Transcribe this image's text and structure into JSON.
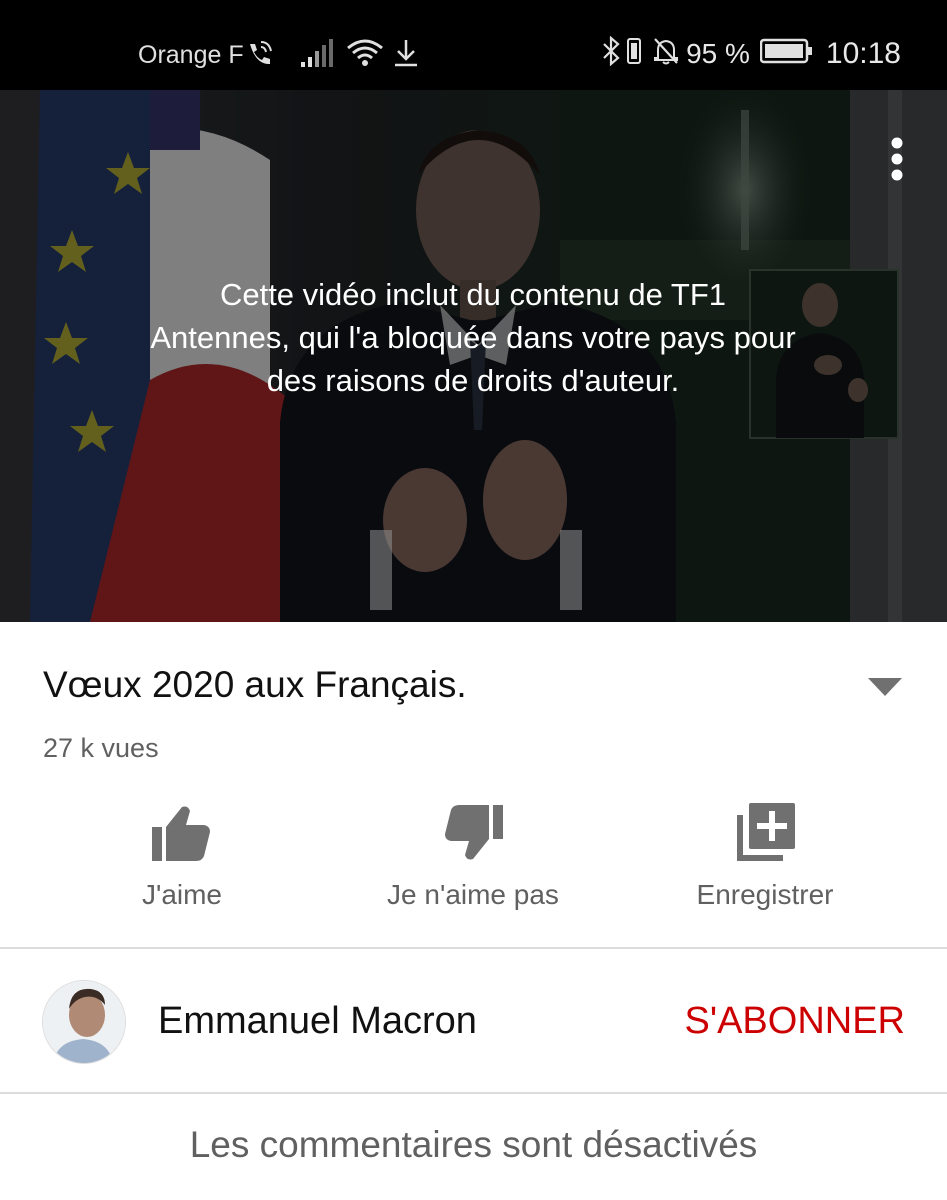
{
  "status_bar": {
    "carrier": "Orange F",
    "battery_percent": "95 %",
    "time": "10:18",
    "icons": [
      "wifi-calling-icon",
      "signal-icon",
      "wifi-icon",
      "download-icon",
      "bluetooth-icon",
      "vibrate-icon",
      "notifications-off-icon",
      "battery-icon"
    ]
  },
  "player": {
    "blocked_message": "Cette vidéo inclut du contenu de TF1 Antennes, qui l'a bloquée dans votre pays pour des raisons de droits d'auteur.",
    "menu_icon": "more-vert-icon"
  },
  "video": {
    "title": "Vœux 2020 aux Français.",
    "views": "27 k vues",
    "expand_icon": "expand-caret-icon"
  },
  "actions": [
    {
      "label": "J'aime",
      "icon": "thumb-up-icon"
    },
    {
      "label": "Je n'aime pas",
      "icon": "thumb-down-icon"
    },
    {
      "label": "Enregistrer",
      "icon": "add-to-playlist-icon"
    }
  ],
  "channel": {
    "name": "Emmanuel Macron",
    "subscribe_label": "S'ABONNER"
  },
  "comments": {
    "disabled_text": "Les commentaires sont désactivés"
  },
  "colors": {
    "subscribe": "#cc0000",
    "secondary_text": "#606060",
    "icon_gray": "#707070"
  }
}
